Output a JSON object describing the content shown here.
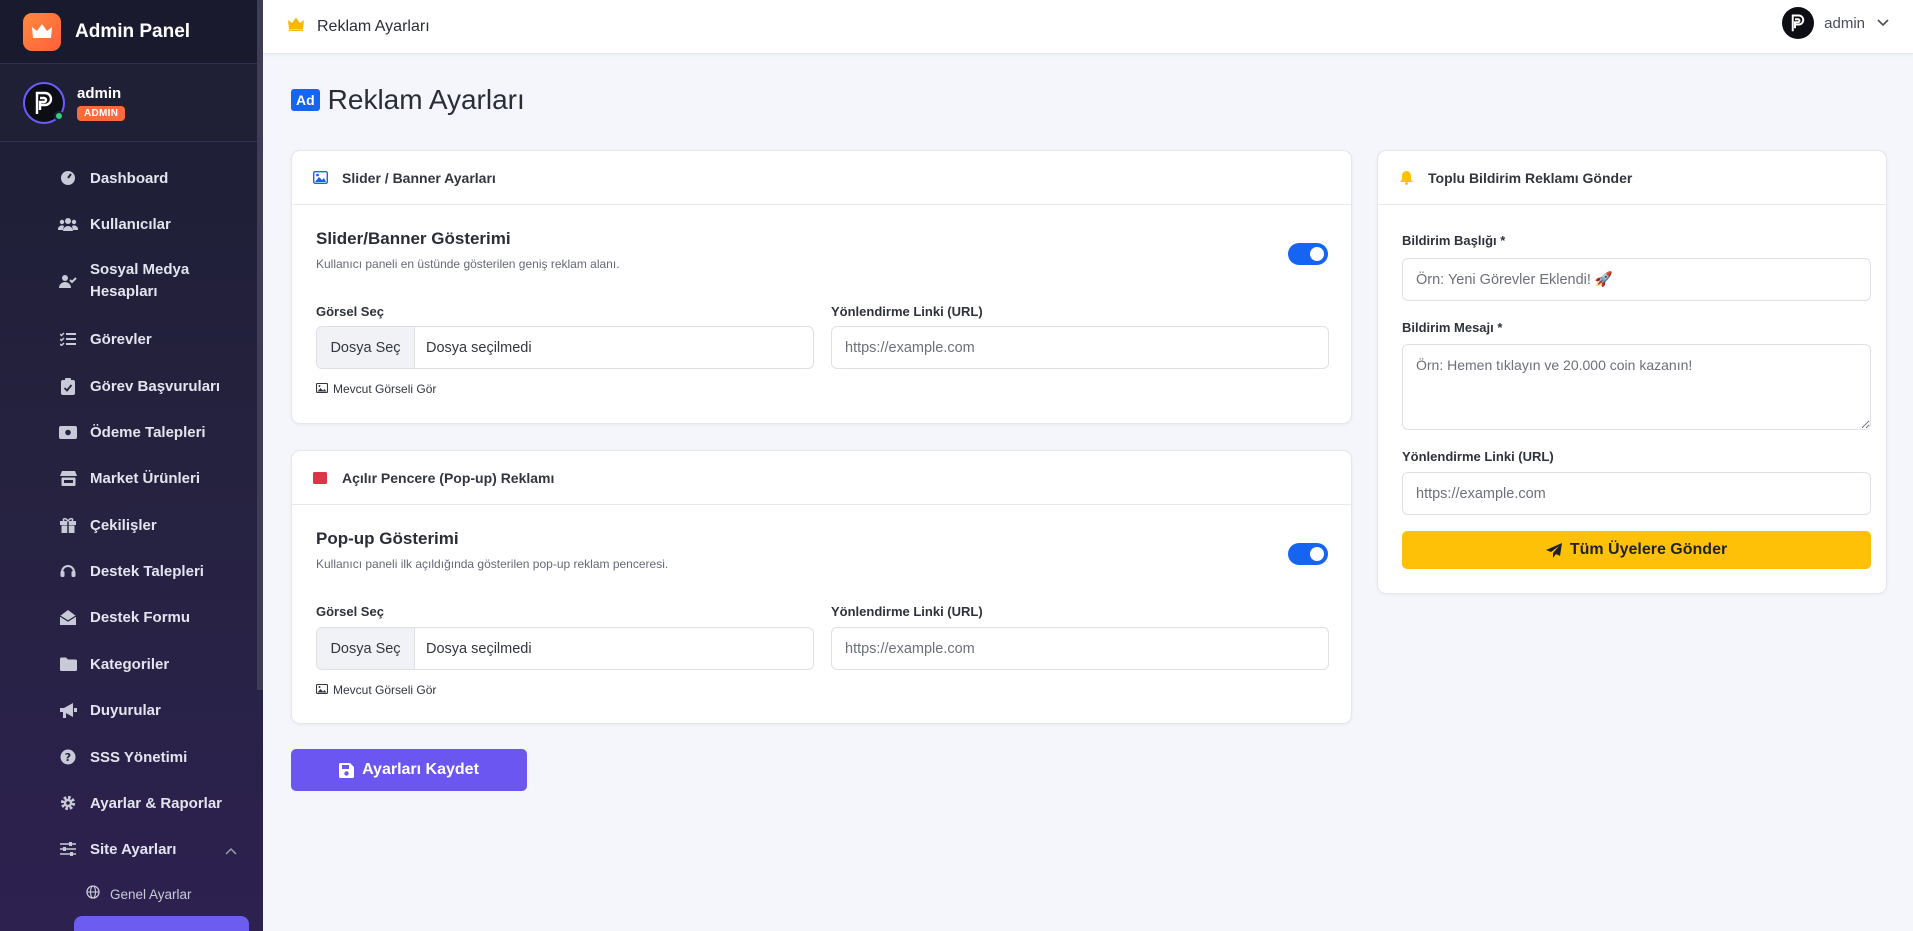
{
  "brand": {
    "title": "Admin Panel"
  },
  "user": {
    "name": "admin",
    "role": "ADMIN"
  },
  "sidebar": {
    "items": [
      {
        "label": "Dashboard"
      },
      {
        "label": "Kullanıcılar"
      },
      {
        "label": "Sosyal Medya Hesapları"
      },
      {
        "label": "Görevler"
      },
      {
        "label": "Görev Başvuruları"
      },
      {
        "label": "Ödeme Talepleri"
      },
      {
        "label": "Market Ürünleri"
      },
      {
        "label": "Çekilişler"
      },
      {
        "label": "Destek Talepleri"
      },
      {
        "label": "Destek Formu"
      },
      {
        "label": "Kategoriler"
      },
      {
        "label": "Duyurular"
      },
      {
        "label": "SSS Yönetimi"
      },
      {
        "label": "Ayarlar & Raporlar"
      },
      {
        "label": "Site Ayarları"
      }
    ],
    "sub_items": [
      {
        "label": "Genel Ayarlar"
      }
    ]
  },
  "topbar": {
    "title": "Reklam Ayarları",
    "user_name": "admin"
  },
  "page": {
    "badge": "Ad",
    "title": "Reklam Ayarları"
  },
  "slider": {
    "header": "Slider / Banner Ayarları",
    "section_title": "Slider/Banner Gösterimi",
    "section_desc": "Kullanıcı paneli en üstünde gösterilen geniş reklam alanı.",
    "enabled": true,
    "image_label": "Görsel Seç",
    "file_button": "Dosya Seç",
    "file_name": "Dosya seçilmedi",
    "link_label": "Yönlendirme Linki (URL)",
    "link_placeholder": "https://example.com",
    "view_link": "Mevcut Görseli Gör"
  },
  "popup": {
    "header": "Açılır Pencere (Pop-up) Reklamı",
    "section_title": "Pop-up Gösterimi",
    "section_desc": "Kullanıcı paneli ilk açıldığında gösterilen pop-up reklam penceresi.",
    "enabled": true,
    "image_label": "Görsel Seç",
    "file_button": "Dosya Seç",
    "file_name": "Dosya seçilmedi",
    "link_label": "Yönlendirme Linki (URL)",
    "link_placeholder": "https://example.com",
    "view_link": "Mevcut Görseli Gör"
  },
  "save_button": "Ayarları Kaydet",
  "notification": {
    "header": "Toplu Bildirim Reklamı Gönder",
    "title_label": "Bildirim Başlığı *",
    "title_placeholder": "Örn: Yeni Görevler Eklendi! 🚀",
    "message_label": "Bildirim Mesajı *",
    "message_placeholder": "Örn: Hemen tıklayın ve 20.000 coin kazanın!",
    "link_label": "Yönlendirme Linki (URL)",
    "link_placeholder": "https://example.com",
    "send_button": "Tüm Üyelere Gönder"
  },
  "colors": {
    "primary": "#1565f2",
    "save": "#6c56f2",
    "send": "#ffc107",
    "danger_icon": "#dc3545",
    "brand": "#ff6a3d"
  }
}
